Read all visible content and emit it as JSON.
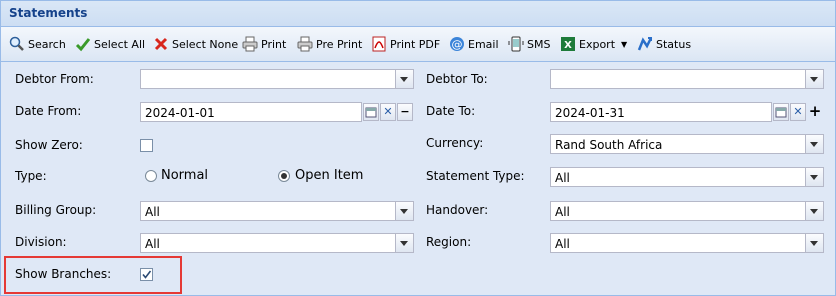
{
  "panel": {
    "title": "Statements"
  },
  "toolbar": {
    "search": "Search",
    "select_all": "Select All",
    "select_none": "Select None",
    "print": "Print",
    "pre_print": "Pre Print",
    "print_pdf": "Print PDF",
    "email": "Email",
    "sms": "SMS",
    "export": "Export",
    "status": "Status"
  },
  "form": {
    "debtor_from": {
      "label": "Debtor From:",
      "value": ""
    },
    "debtor_to": {
      "label": "Debtor To:",
      "value": ""
    },
    "date_from": {
      "label": "Date From:",
      "value": "2024-01-01"
    },
    "date_to": {
      "label": "Date To:",
      "value": "2024-01-31"
    },
    "show_zero": {
      "label": "Show Zero:",
      "checked": false
    },
    "currency": {
      "label": "Currency:",
      "value": "Rand South Africa"
    },
    "type": {
      "label": "Type:",
      "options": [
        "Normal",
        "Open Item"
      ],
      "selected": "Open Item"
    },
    "statement_type": {
      "label": "Statement Type:",
      "value": "All"
    },
    "billing_group": {
      "label": "Billing Group:",
      "value": "All"
    },
    "handover": {
      "label": "Handover:",
      "value": "All"
    },
    "division": {
      "label": "Division:",
      "value": "All"
    },
    "region": {
      "label": "Region:",
      "value": "All"
    },
    "show_branches": {
      "label": "Show Branches:",
      "checked": true
    }
  },
  "colors": {
    "panel_bg": "#dfe8f6",
    "title_text": "#15428b",
    "highlight": "#e53935"
  }
}
